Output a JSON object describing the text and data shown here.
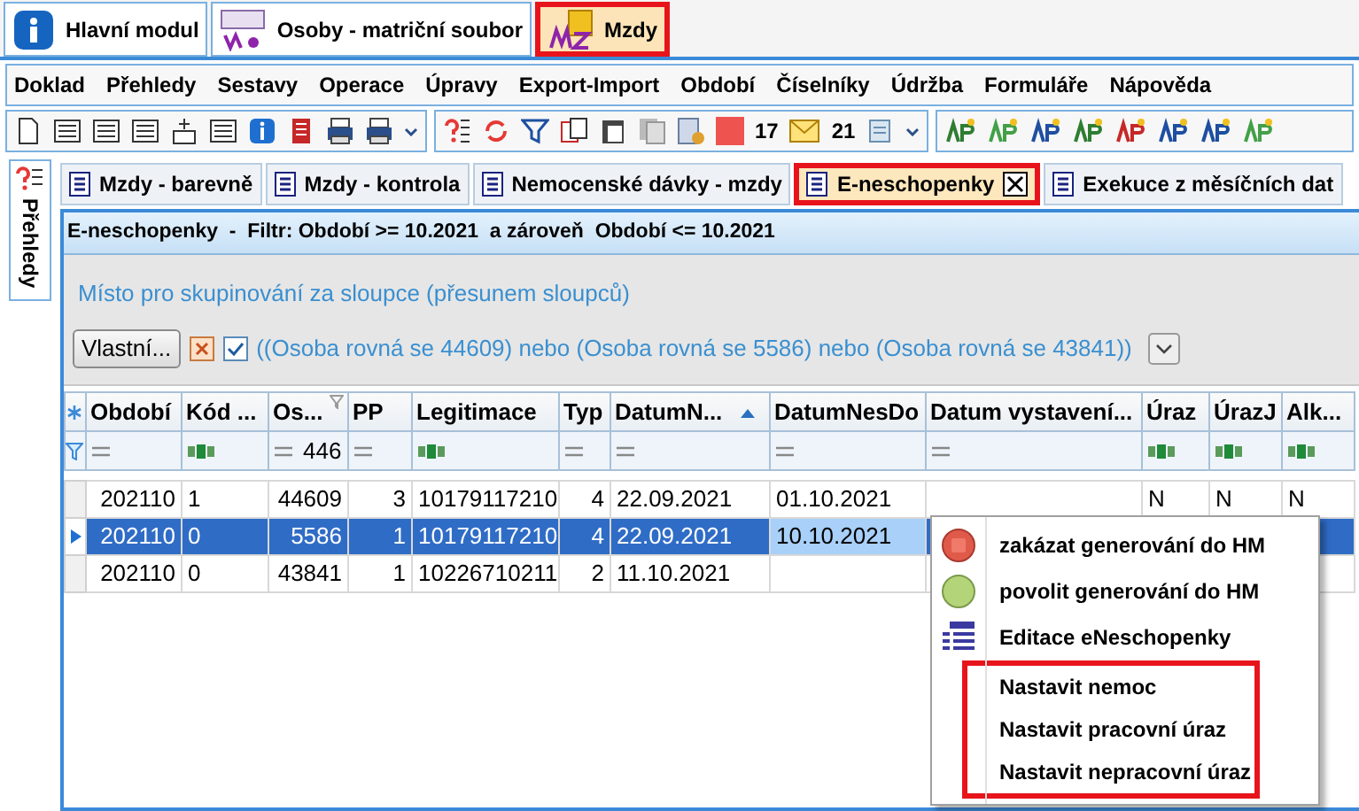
{
  "module_tabs": [
    {
      "label": "Hlavní modul",
      "kind": "info",
      "selected": false,
      "highlighted": false
    },
    {
      "label": "Osoby - matriční soubor",
      "kind": "persons",
      "selected": false,
      "highlighted": false
    },
    {
      "label": "Mzdy",
      "kind": "wages",
      "selected": true,
      "highlighted": true
    }
  ],
  "menu": [
    "Doklad",
    "Přehledy",
    "Sestavy",
    "Operace",
    "Úpravy",
    "Export-Import",
    "Období",
    "Číselníky",
    "Údržba",
    "Formuláře",
    "Nápověda"
  ],
  "toolbar": {
    "counts": [
      "17",
      "21"
    ]
  },
  "side_tab": {
    "label": "Přehledy"
  },
  "doc_tabs": [
    {
      "label": "Mzdy - barevně",
      "selected": false,
      "highlighted": false
    },
    {
      "label": "Mzdy - kontrola",
      "selected": false,
      "highlighted": false
    },
    {
      "label": "Nemocenské dávky - mzdy",
      "selected": false,
      "highlighted": false
    },
    {
      "label": "E-neschopenky",
      "selected": true,
      "highlighted": true
    },
    {
      "label": "Exekuce z měsíčních dat",
      "selected": false,
      "highlighted": false
    }
  ],
  "filter_header": "E-neschopenky  -  Filtr: Období >= 10.2021  a zároveň  Období <= 10.2021",
  "group_hint": "Místo pro skupinování za sloupce (přesunem sloupců)",
  "filter_bar": {
    "button": "Vlastní...",
    "active": true,
    "expression": "((Osoba rovná se 44609) nebo (Osoba rovná se 5586) nebo (Osoba rovná se 43841))"
  },
  "grid": {
    "columns": [
      {
        "label": "Období"
      },
      {
        "label": "Kód ..."
      },
      {
        "label": "Os...",
        "filtered": true
      },
      {
        "label": "PP"
      },
      {
        "label": "Legitimace"
      },
      {
        "label": "Typ"
      },
      {
        "label": "DatumN...",
        "sorted_ascending": true
      },
      {
        "label": "DatumNesDo"
      },
      {
        "label": "Datum vystavení..."
      },
      {
        "label": "Úraz"
      },
      {
        "label": "ÚrazJ"
      },
      {
        "label": "Alk..."
      }
    ],
    "filters": [
      {
        "kind": "eq"
      },
      {
        "kind": "text"
      },
      {
        "kind": "eq",
        "value": "446"
      },
      {
        "kind": "eq"
      },
      {
        "kind": "text"
      },
      {
        "kind": "eq"
      },
      {
        "kind": "eq"
      },
      {
        "kind": "eq"
      },
      {
        "kind": "eq"
      },
      {
        "kind": "text"
      },
      {
        "kind": "text"
      },
      {
        "kind": "text"
      }
    ],
    "rows": [
      {
        "selected": false,
        "cells": [
          "202110",
          "1",
          "44609",
          "3",
          "10179117210",
          "4",
          "22.09.2021",
          "01.10.2021",
          null,
          "N",
          "N",
          "N"
        ]
      },
      {
        "selected": true,
        "cells": [
          "202110",
          "0",
          "5586",
          "1",
          "10179117210",
          "4",
          "22.09.2021",
          {
            "text": "10.10.2021",
            "focused": true
          },
          null,
          null,
          null,
          null
        ]
      },
      {
        "selected": false,
        "cells": [
          "202110",
          "0",
          "43841",
          "1",
          "10226710211",
          "2",
          "11.10.2021",
          null,
          null,
          null,
          null,
          null
        ]
      }
    ]
  },
  "context_menu": [
    {
      "label": "zakázat generování do HM",
      "kind": "disable",
      "highlighted": false
    },
    {
      "label": "povolit generování do HM",
      "kind": "enable",
      "highlighted": false
    },
    {
      "label": "Editace eNeschopenky",
      "kind": "edit",
      "highlighted": false
    },
    {
      "label": "Nastavit nemoc",
      "kind": "plain",
      "highlighted": true
    },
    {
      "label": "Nastavit pracovní úraz",
      "kind": "plain",
      "highlighted": true
    },
    {
      "label": "Nastavit nepracovní úraz",
      "kind": "plain",
      "highlighted": true
    }
  ]
}
